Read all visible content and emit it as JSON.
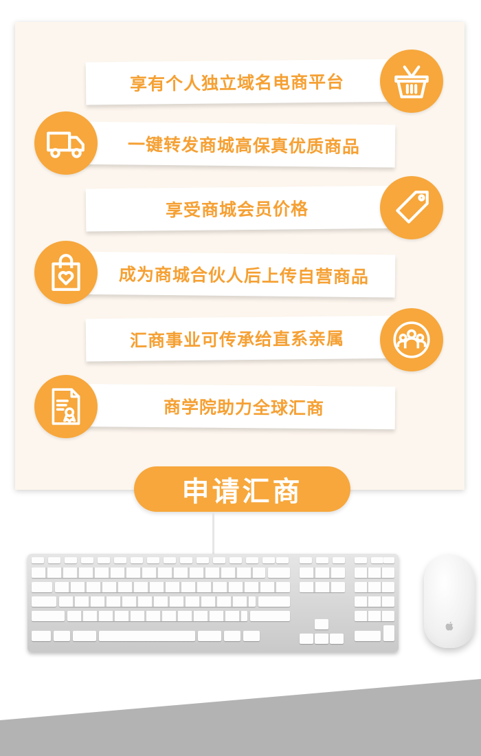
{
  "features": [
    {
      "text": "享有个人独立域名电商平台",
      "icon": "basket-icon"
    },
    {
      "text": "一键转发商城高保真优质商品",
      "icon": "truck-icon"
    },
    {
      "text": "享受商城会员价格",
      "icon": "tag-icon"
    },
    {
      "text": "成为商城合伙人后上传自营商品",
      "icon": "shopping-bag-heart-icon"
    },
    {
      "text": "汇商事业可传承给直系亲属",
      "icon": "people-group-icon"
    },
    {
      "text": "商学院助力全球汇商",
      "icon": "certificate-document-icon"
    }
  ],
  "apply_button": {
    "label": "申请汇商"
  },
  "colors": {
    "accent": "#f7a73b",
    "text_accent": "#f5a033",
    "panel_bg": "#fdf6ee",
    "floor": "#b3b3b3"
  }
}
